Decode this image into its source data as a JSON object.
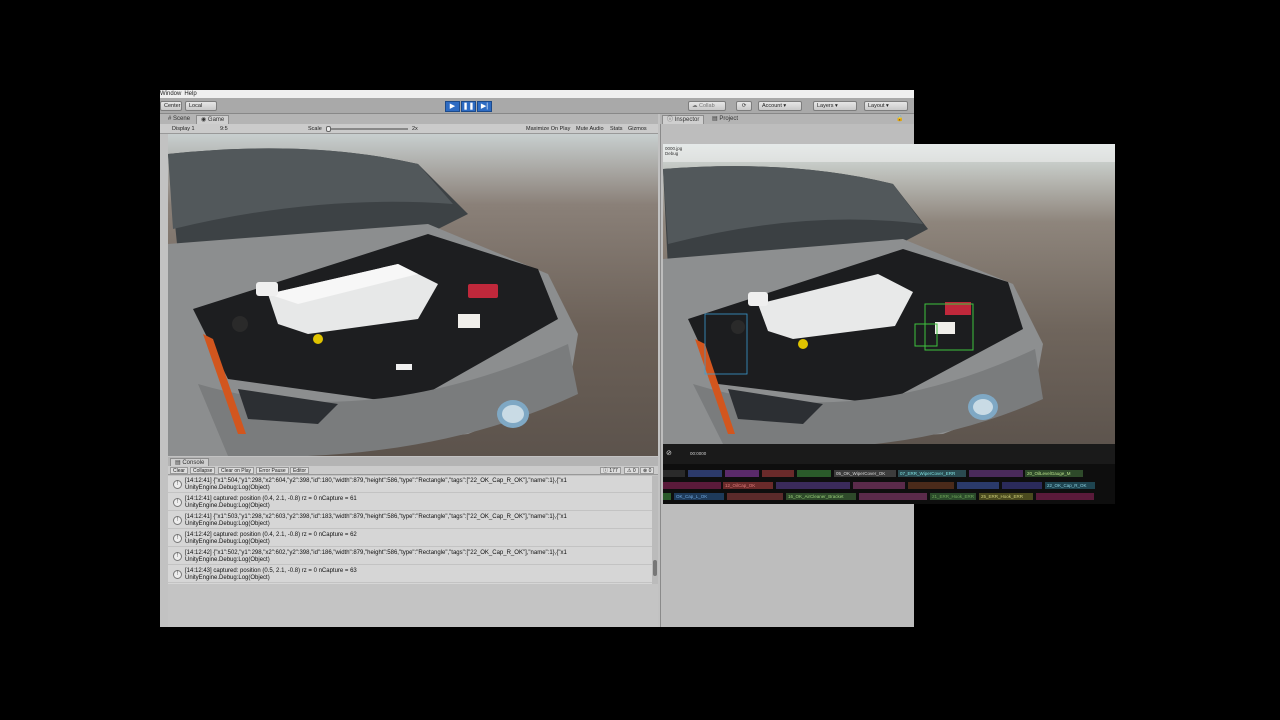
{
  "menu": [
    "Window",
    "Help"
  ],
  "toolbar": {
    "center": "Center",
    "local": "Local",
    "collab": "Collab",
    "account": "Account",
    "layers": "Layers",
    "layout": "Layout",
    "play_icon": "play-icon",
    "pause_icon": "pause-icon",
    "step_icon": "step-icon"
  },
  "game_tabs": {
    "scene": "Scene",
    "game": "Game"
  },
  "game_bar": {
    "display": "Display 1",
    "aspect": "9:5",
    "scale_label": "Scale",
    "scale_value": "2x",
    "maximize": "Maximize On Play",
    "mute": "Mute Audio",
    "stats": "Stats",
    "gizmos": "Gizmos"
  },
  "inspector_tabs": {
    "inspector": "Inspector",
    "project": "Project"
  },
  "overlay": {
    "filename": "0000.jpg",
    "debug": "Debug",
    "frame": "00:0000"
  },
  "console": {
    "tab": "Console",
    "buttons": [
      "Clear",
      "Collapse",
      "Clear on Play",
      "Error Pause",
      "Editor"
    ],
    "counts": {
      "log": "177",
      "warn": "0",
      "error": "0"
    },
    "logs": [
      {
        "line1": "[14:12:41] {\"x1\":504,\"y1\":298,\"x2\":604,\"y2\":398,\"id\":180,\"width\":879,\"height\":586,\"type\":\"Rectangle\",\"tags\":[\"22_OK_Cap_R_OK\"],\"name\":1},{\"x1",
        "line2": "UnityEngine.Debug:Log(Object)"
      },
      {
        "line1": "[14:12:41] captured: position (0.4, 2.1, -0.8)  rz = 0 nCapture = 61",
        "line2": "UnityEngine.Debug:Log(Object)"
      },
      {
        "line1": "[14:12:41] {\"x1\":503,\"y1\":298,\"x2\":603,\"y2\":398,\"id\":183,\"width\":879,\"height\":586,\"type\":\"Rectangle\",\"tags\":[\"22_OK_Cap_R_OK\"],\"name\":1},{\"x1",
        "line2": "UnityEngine.Debug:Log(Object)"
      },
      {
        "line1": "[14:12:42] captured: position (0.4, 2.1, -0.8)  rz = 0 nCapture = 62",
        "line2": "UnityEngine.Debug:Log(Object)"
      },
      {
        "line1": "[14:12:42] {\"x1\":502,\"y1\":298,\"x2\":602,\"y2\":398,\"id\":186,\"width\":879,\"height\":586,\"type\":\"Rectangle\",\"tags\":[\"22_OK_Cap_R_OK\"],\"name\":1},{\"x1",
        "line2": "UnityEngine.Debug:Log(Object)"
      },
      {
        "line1": "[14:12:43] captured: position (0.5, 2.1, -0.8)  rz = 0 nCapture = 63",
        "line2": "UnityEngine.Debug:Log(Object)"
      }
    ]
  },
  "tags_row1": [
    {
      "label": "05_OK_WiperCover_OK",
      "color": "#d9d9d9"
    },
    {
      "label": "07_ERR_WiperCover_ERR",
      "color": "#7de0e0"
    },
    {
      "label": "20_OilLevelGauge_M",
      "color": "#b8e08a"
    }
  ],
  "tags_row2": [
    {
      "label": "12_OilCap_OK",
      "color": "#e07a7a"
    },
    {
      "label": "22_OK_Cap_R_OK",
      "color": "#8ad0e0"
    }
  ],
  "tags_row3": [
    {
      "label": "OK_Cap_L_OK",
      "color": "#6fa8e0"
    },
    {
      "label": "16_OK_AirCleaner_Bracket",
      "color": "#9ad07a"
    },
    {
      "label": "21_ERR_Hook_ERR",
      "color": "#6fa85a"
    },
    {
      "label": "25_ERR_Hook_ERR",
      "color": "#d0d07a"
    }
  ],
  "colors": {
    "accent": "#2d6bc3",
    "window_bg": "#c2c2c2",
    "bbox_green": "#3ec23e",
    "bbox_cyan": "#3a9bd0"
  }
}
